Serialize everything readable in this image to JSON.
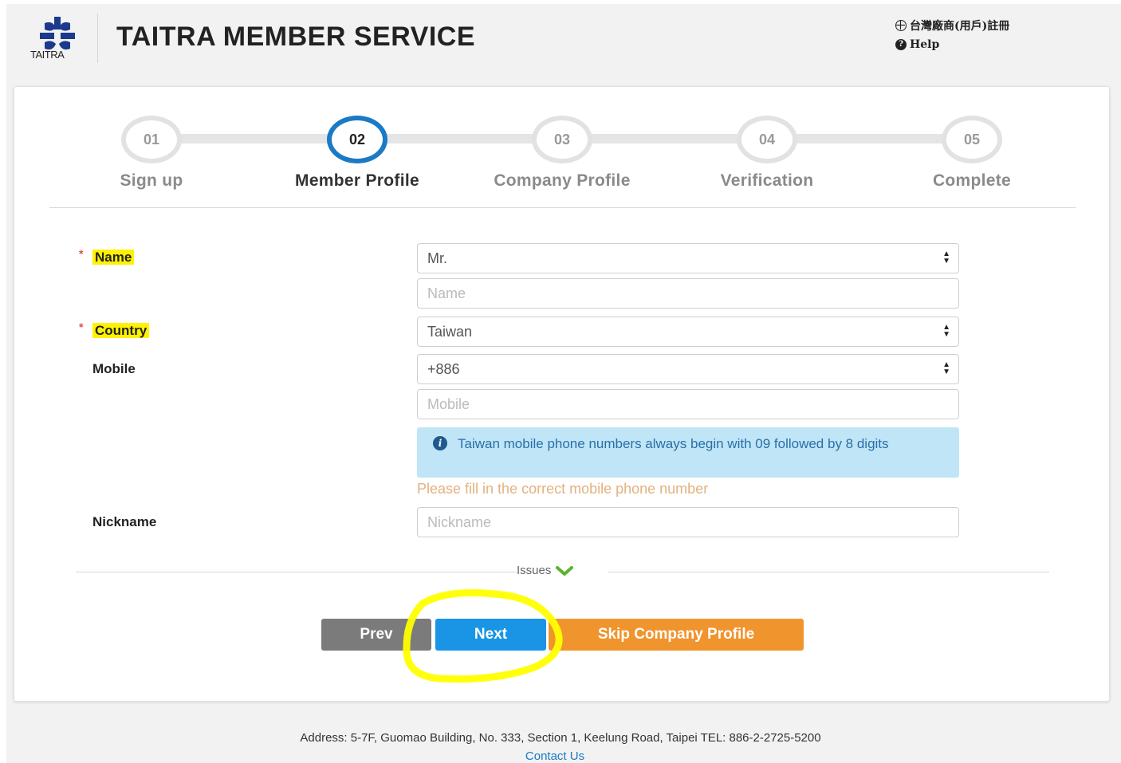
{
  "header": {
    "logo_text": "TAITRA",
    "title": "TAITRA MEMBER SERVICE",
    "links": [
      {
        "icon": "globe-icon",
        "label": "台灣廠商(用戶)註冊"
      },
      {
        "icon": "help-icon",
        "label": "Help"
      }
    ]
  },
  "stepper": {
    "active_index": 1,
    "steps": [
      {
        "number": "01",
        "label": "Sign up"
      },
      {
        "number": "02",
        "label": "Member Profile"
      },
      {
        "number": "03",
        "label": "Company Profile"
      },
      {
        "number": "04",
        "label": "Verification"
      },
      {
        "number": "05",
        "label": "Complete"
      }
    ]
  },
  "form": {
    "required_mark": "*",
    "name_label": "Name",
    "title_select_value": "Mr.",
    "name_placeholder": "Name",
    "country_label": "Country",
    "country_value": "Taiwan",
    "mobile_label": "Mobile",
    "dial_code_value": "+886",
    "mobile_placeholder": "Mobile",
    "info_text": "Taiwan mobile phone numbers always begin with 09 followed by 8 digits",
    "error_text": "Please fill in the correct mobile phone number",
    "nickname_label": "Nickname",
    "nickname_placeholder": "Nickname",
    "issues_label": "Issues"
  },
  "buttons": {
    "prev": "Prev",
    "next": "Next",
    "skip": "Skip Company Profile"
  },
  "footer": {
    "address": "Address: 5-7F, Guomao Building, No. 333, Section 1, Keelung Road, Taipei TEL: 886-2-2725-5200",
    "contact": "Contact Us"
  },
  "colors": {
    "accent": "#1a7ac5",
    "highlight": "#fff200",
    "next_button": "#1a95e5",
    "skip_button": "#f0942e",
    "prev_button": "#7b7b7b",
    "annotation": "#ffff00"
  }
}
